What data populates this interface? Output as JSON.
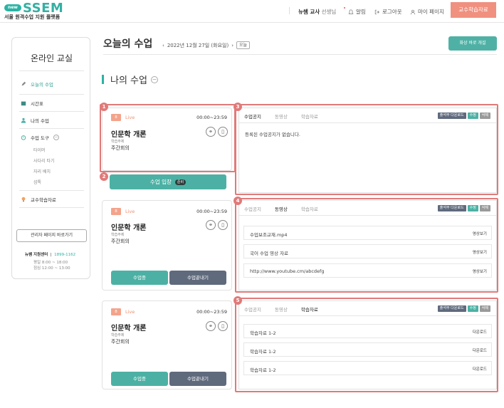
{
  "header": {
    "logo_badge": "new",
    "logo": "SSEM",
    "logo_sub": "서울 원격수업 지원 플랫폼",
    "user_name": "뉴쌤 교사",
    "user_suffix": "선생님",
    "alarm": "알림",
    "logout": "로그아웃",
    "mypage": "마이 페이지",
    "materials_btn": "교수학습자료"
  },
  "sidebar": {
    "title": "온라인 교실",
    "items": [
      {
        "label": "오늘의 수업",
        "icon": "pencil-icon"
      },
      {
        "label": "시간표",
        "icon": "calendar-icon"
      },
      {
        "label": "나의 수업",
        "icon": "person-icon"
      },
      {
        "label": "수업 도구",
        "icon": "timer-icon"
      },
      {
        "label": "교수학습자료",
        "icon": "bulb-icon"
      }
    ],
    "tools": [
      "타이머",
      "사다리 타기",
      "자리 배치",
      "섬톡"
    ],
    "admin_btn": "관리자 페이지 바로가기",
    "center_label": "뉴쌤 지원센터",
    "center_phone": "1899-1162",
    "hours1": "평일 8:00 ~ 18:00",
    "hours2": "점심 12:00 ~ 13:00"
  },
  "main": {
    "page_title": "오늘의 수업",
    "date": "2022년 12월 27일 (화요일)",
    "today_btn": "오늘",
    "room_btn": "화상 바로 개설",
    "section_title": "나의 수업"
  },
  "cards": [
    {
      "period": "8",
      "live": "Live",
      "time": "00:00~23:59",
      "name": "인문학 개론",
      "tag": "학습주제",
      "meeting": "주간회의"
    },
    {
      "period": "8",
      "live": "Live",
      "time": "00:00~23:59",
      "name": "인문학 개론",
      "tag": "학습주제",
      "meeting": "주간회의"
    },
    {
      "period": "8",
      "live": "Live",
      "time": "00:00~23:59",
      "name": "인문학 개론",
      "tag": "학습주제",
      "meeting": "주간회의"
    }
  ],
  "buttons": {
    "enter": "수업 입장",
    "enter_pill": "준비",
    "in_class": "수업중",
    "end_class": "수업끝내기"
  },
  "panel_tabs": [
    "수업공지",
    "동영상",
    "학습자료"
  ],
  "panel_actions": [
    "출석부 다운로드",
    "수정",
    "삭제"
  ],
  "panel1": {
    "notice": "등록된 수업공지가 없습니다."
  },
  "panel2": {
    "rows": [
      {
        "label": "수업보조교재.mp4",
        "action": "영상보기"
      },
      {
        "label": "국어 수업 영상 자료",
        "action": "영상보기"
      },
      {
        "label": "http://www.youtube.cm/abcdefg",
        "action": "영상보기"
      }
    ]
  },
  "panel3": {
    "rows": [
      {
        "label": "학습자료 1-2",
        "action": "다운로드"
      },
      {
        "label": "학습자료 1-2",
        "action": "다운로드"
      },
      {
        "label": "학습자료 1-2",
        "action": "다운로드"
      }
    ]
  },
  "markers": [
    "1",
    "2",
    "3",
    "4",
    "5"
  ],
  "colors": {
    "accent": "#2bb3a4",
    "highlight": "#e07a79",
    "orange": "#f0907f"
  }
}
